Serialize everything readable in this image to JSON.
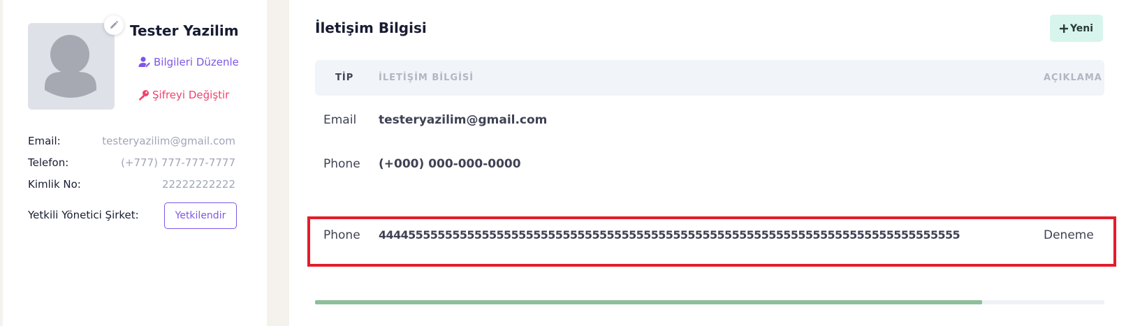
{
  "profile": {
    "name": "Tester Yazilim",
    "edit_link": "Bilgileri Düzenle",
    "password_link": "Şifreyi Değiştir",
    "fields": [
      {
        "label": "Email:",
        "value": "testeryazilim@gmail.com"
      },
      {
        "label": "Telefon:",
        "value": "(+777) 777-777-7777"
      },
      {
        "label": "Kimlik No:",
        "value": "22222222222"
      }
    ],
    "company_label": "Yetkili Yönetici Şirket:",
    "company_button": "Yetkilendir"
  },
  "contact": {
    "title": "İletişim Bilgisi",
    "new_button": "Yeni",
    "columns": {
      "type": "TİP",
      "info": "İLETİŞİM BİLGİSİ",
      "description": "AÇIKLAMA"
    },
    "rows": [
      {
        "type": "Email",
        "info": "testeryazilim@gmail.com",
        "description": ""
      },
      {
        "type": "Phone",
        "info": "(+000) 000-000-0000",
        "description": ""
      },
      {
        "type": "Phone",
        "info": "4444555555555555555555555555555555555555555555555555555555555555555555555555555",
        "description": "Deneme"
      }
    ],
    "scroll_fraction": 0.845
  },
  "colors": {
    "accent": "#7e57e6",
    "danger": "#f1416c",
    "highlight": "#e41c2a",
    "success_light": "#d7f5ec",
    "scroll_thumb": "#8dbf9a"
  },
  "icons": [
    "pencil-icon",
    "user-edit-icon",
    "key-icon",
    "plus-icon",
    "avatar-placeholder-icon"
  ]
}
